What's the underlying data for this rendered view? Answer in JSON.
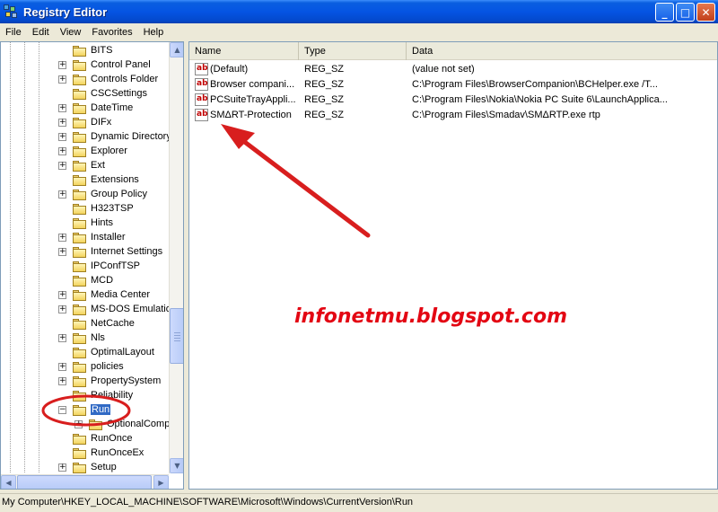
{
  "window": {
    "title": "Registry Editor",
    "buttons": {
      "minimize": "_",
      "maximize": "□",
      "close": "✕"
    }
  },
  "menu": [
    "File",
    "Edit",
    "View",
    "Favorites",
    "Help"
  ],
  "tree": {
    "items": [
      {
        "label": "BITS",
        "expander": ""
      },
      {
        "label": "Control Panel",
        "expander": "+"
      },
      {
        "label": "Controls Folder",
        "expander": "+"
      },
      {
        "label": "CSCSettings",
        "expander": ""
      },
      {
        "label": "DateTime",
        "expander": "+"
      },
      {
        "label": "DIFx",
        "expander": "+"
      },
      {
        "label": "Dynamic Directory",
        "expander": "+"
      },
      {
        "label": "Explorer",
        "expander": "+"
      },
      {
        "label": "Ext",
        "expander": "+"
      },
      {
        "label": "Extensions",
        "expander": ""
      },
      {
        "label": "Group Policy",
        "expander": "+"
      },
      {
        "label": "H323TSP",
        "expander": ""
      },
      {
        "label": "Hints",
        "expander": ""
      },
      {
        "label": "Installer",
        "expander": "+"
      },
      {
        "label": "Internet Settings",
        "expander": "+"
      },
      {
        "label": "IPConfTSP",
        "expander": ""
      },
      {
        "label": "MCD",
        "expander": ""
      },
      {
        "label": "Media Center",
        "expander": "+"
      },
      {
        "label": "MS-DOS Emulation",
        "expander": "+"
      },
      {
        "label": "NetCache",
        "expander": ""
      },
      {
        "label": "Nls",
        "expander": "+"
      },
      {
        "label": "OptimalLayout",
        "expander": ""
      },
      {
        "label": "policies",
        "expander": "+"
      },
      {
        "label": "PropertySystem",
        "expander": "+"
      },
      {
        "label": "Reliability",
        "expander": ""
      },
      {
        "label": "Run",
        "expander": "−",
        "selected": true
      },
      {
        "label": "OptionalComp",
        "expander": "+",
        "child": true
      },
      {
        "label": "RunOnce",
        "expander": ""
      },
      {
        "label": "RunOnceEx",
        "expander": ""
      },
      {
        "label": "Setup",
        "expander": "+"
      }
    ]
  },
  "scroll_arrows": {
    "up": "▲",
    "down": "▼",
    "left": "◀",
    "right": "▶"
  },
  "columns": [
    "Name",
    "Type",
    "Data"
  ],
  "values": [
    {
      "icon": "ab",
      "name": "(Default)",
      "type": "REG_SZ",
      "data": "(value not set)"
    },
    {
      "icon": "ab",
      "name": "Browser compani...",
      "type": "REG_SZ",
      "data": "C:\\Program Files\\BrowserCompanion\\BCHelper.exe /T..."
    },
    {
      "icon": "ab",
      "name": "PCSuiteTrayAppli...",
      "type": "REG_SZ",
      "data": "C:\\Program Files\\Nokia\\Nokia PC Suite 6\\LaunchApplica..."
    },
    {
      "icon": "ab",
      "name": "SMΔRT-Protection",
      "type": "REG_SZ",
      "data": "C:\\Program Files\\Smadav\\SMΔRTP.exe rtp"
    }
  ],
  "watermark": "infonetmu.blogspot.com",
  "status": "My Computer\\HKEY_LOCAL_MACHINE\\SOFTWARE\\Microsoft\\Windows\\CurrentVersion\\Run",
  "colors": {
    "annotation": "#d81e1e",
    "selection": "#316ac5",
    "watermark": "#e30613"
  }
}
